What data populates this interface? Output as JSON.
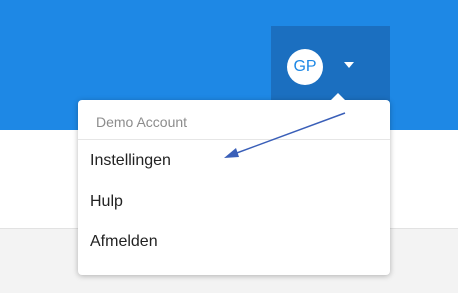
{
  "header": {
    "background_color": "#1e88e5",
    "account_button_color": "#1b6fc0"
  },
  "account": {
    "initials": "GP",
    "caret_icon": "caret-down-icon"
  },
  "dropdown": {
    "account_name": "Demo Account",
    "items": [
      {
        "label": "Instellingen"
      },
      {
        "label": "Hulp"
      },
      {
        "label": "Afmelden"
      }
    ]
  },
  "annotation": {
    "arrow_color": "#3a5fb8",
    "arrow_icon": "annotation-arrow-icon"
  }
}
